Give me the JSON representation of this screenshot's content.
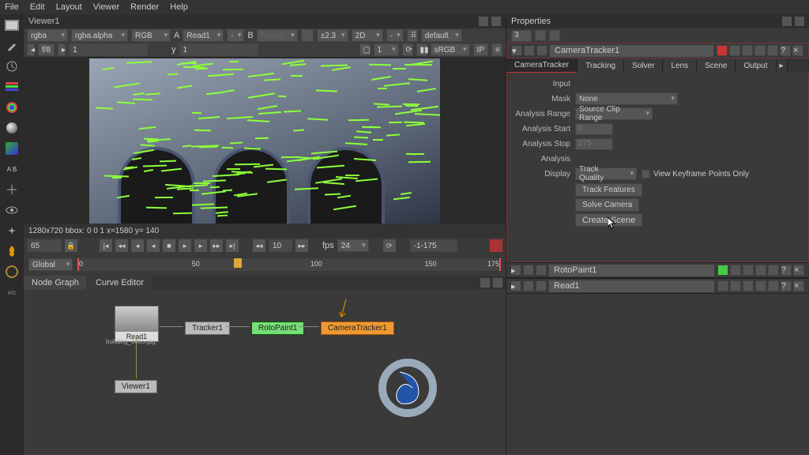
{
  "menu": [
    "File",
    "Edit",
    "Layout",
    "Viewer",
    "Render",
    "Help"
  ],
  "viewer": {
    "title": "Viewer1",
    "channel_a": "rgba",
    "channel_b": "rgba.alpha",
    "mode": "RGB",
    "a_label": "A",
    "a_value": "Read1",
    "a_layer": "-",
    "b_label": "B",
    "b_value": "Read1",
    "exposure": "±2.3",
    "dim": "2D",
    "hidden_select": "-",
    "default": "default",
    "f_label": "f/8",
    "f_value": "1",
    "y_label": "y",
    "y_value": "1",
    "proxy_num": "1",
    "lut": "sRGB",
    "ip": "IP",
    "status": "1280x720 bbox: 0 0 1  x=1580 y= 140",
    "cur_frame": "65",
    "mid_frame": "10",
    "fps_label": "fps",
    "fps_value": "24",
    "range": "-1-175",
    "scope": "Global",
    "ticks": [
      "0",
      "50",
      "100",
      "150",
      "175"
    ]
  },
  "tabs": {
    "nodegraph": "Node Graph",
    "curve": "Curve Editor"
  },
  "nodes": {
    "read": "Read1",
    "read_file": "building_0065.jpg",
    "tracker": "Tracker1",
    "roto": "RotoPaint1",
    "camtrk": "CameraTracker1",
    "viewer": "Viewer1"
  },
  "props": {
    "title": "Properties",
    "maxnodes": "3",
    "noderows": [
      {
        "name": "CameraTracker1",
        "color": "#cc3333"
      },
      {
        "name": "RotoPaint1",
        "color": "#44cc44"
      },
      {
        "name": "Read1",
        "color": "#888"
      }
    ],
    "tabs": [
      "CameraTracker",
      "Tracking",
      "Solver",
      "Lens",
      "Scene",
      "Output"
    ],
    "fields": {
      "input": "Input",
      "mask": "Mask",
      "mask_val": "None",
      "arange": "Analysis Range",
      "arange_val": "Source Clip Range",
      "astart": "Analysis Start",
      "astart_val": "0",
      "astop": "Analysis Stop",
      "astop_val": "175",
      "analysis": "Analysis",
      "display": "Display",
      "display_val": "Track Quality",
      "kfonly": "View Keyframe Points Only",
      "btn1": "Track Features",
      "btn2": "Solve Camera",
      "btn3": "Create Scene"
    }
  }
}
